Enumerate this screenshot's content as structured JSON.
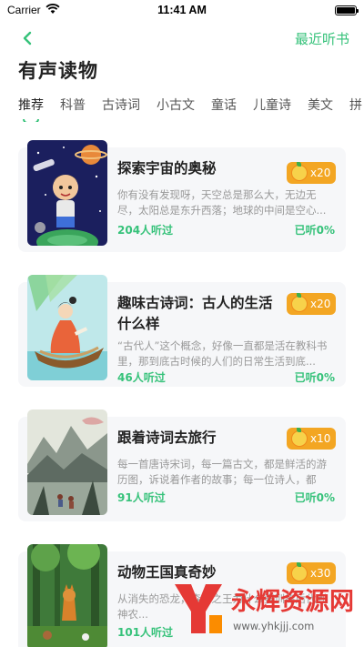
{
  "status_bar": {
    "carrier": "Carrier",
    "time": "11:41 AM"
  },
  "nav": {
    "back_icon": "chevron-left-icon",
    "right_label": "最近听书"
  },
  "page_title": "有声读物",
  "tabs": [
    {
      "label": "推荐",
      "active": true
    },
    {
      "label": "科普"
    },
    {
      "label": "古诗词"
    },
    {
      "label": "小古文"
    },
    {
      "label": "童话"
    },
    {
      "label": "儿童诗"
    },
    {
      "label": "美文"
    },
    {
      "label": "拼"
    }
  ],
  "books": [
    {
      "title": "探索宇宙的奥秘",
      "price": "x20",
      "description": "你有没有发现呀，天空总是那么大，无边无尽，太阳总是东升西落；地球的中间是空心...",
      "listeners": "204人听过",
      "progress": "已听0%",
      "cover": "space-boy-illustration"
    },
    {
      "title": "趣味古诗词：古人的生活什么样",
      "price": "x20",
      "description": "“古代人”这个概念，好像一直都是活在教科书里，那到底古时候的人们的日常生活到底...",
      "listeners": "46人听过",
      "progress": "已听0%",
      "cover": "ancient-girl-boat-illustration"
    },
    {
      "title": "跟着诗词去旅行",
      "price": "x10",
      "description": "每一首唐诗宋词，每一篇古文，都是鲜活的游历图，诉说着作者的故事；每一位诗人，都是...",
      "listeners": "91人听过",
      "progress": "已听0%",
      "cover": "chinese-landscape-painting"
    },
    {
      "title": "动物王国真奇妙",
      "price": "x30",
      "description": "从消失的恐龙，森林之王为什么要训练后代到神农...",
      "listeners": "101人听过",
      "progress": "",
      "cover": "forest-animals-illustration"
    }
  ],
  "watermark": {
    "brand": "永辉资源网",
    "url": "www.yhkjjj.com"
  },
  "colors": {
    "accent": "#36c27a",
    "badge": "#f3a623"
  }
}
